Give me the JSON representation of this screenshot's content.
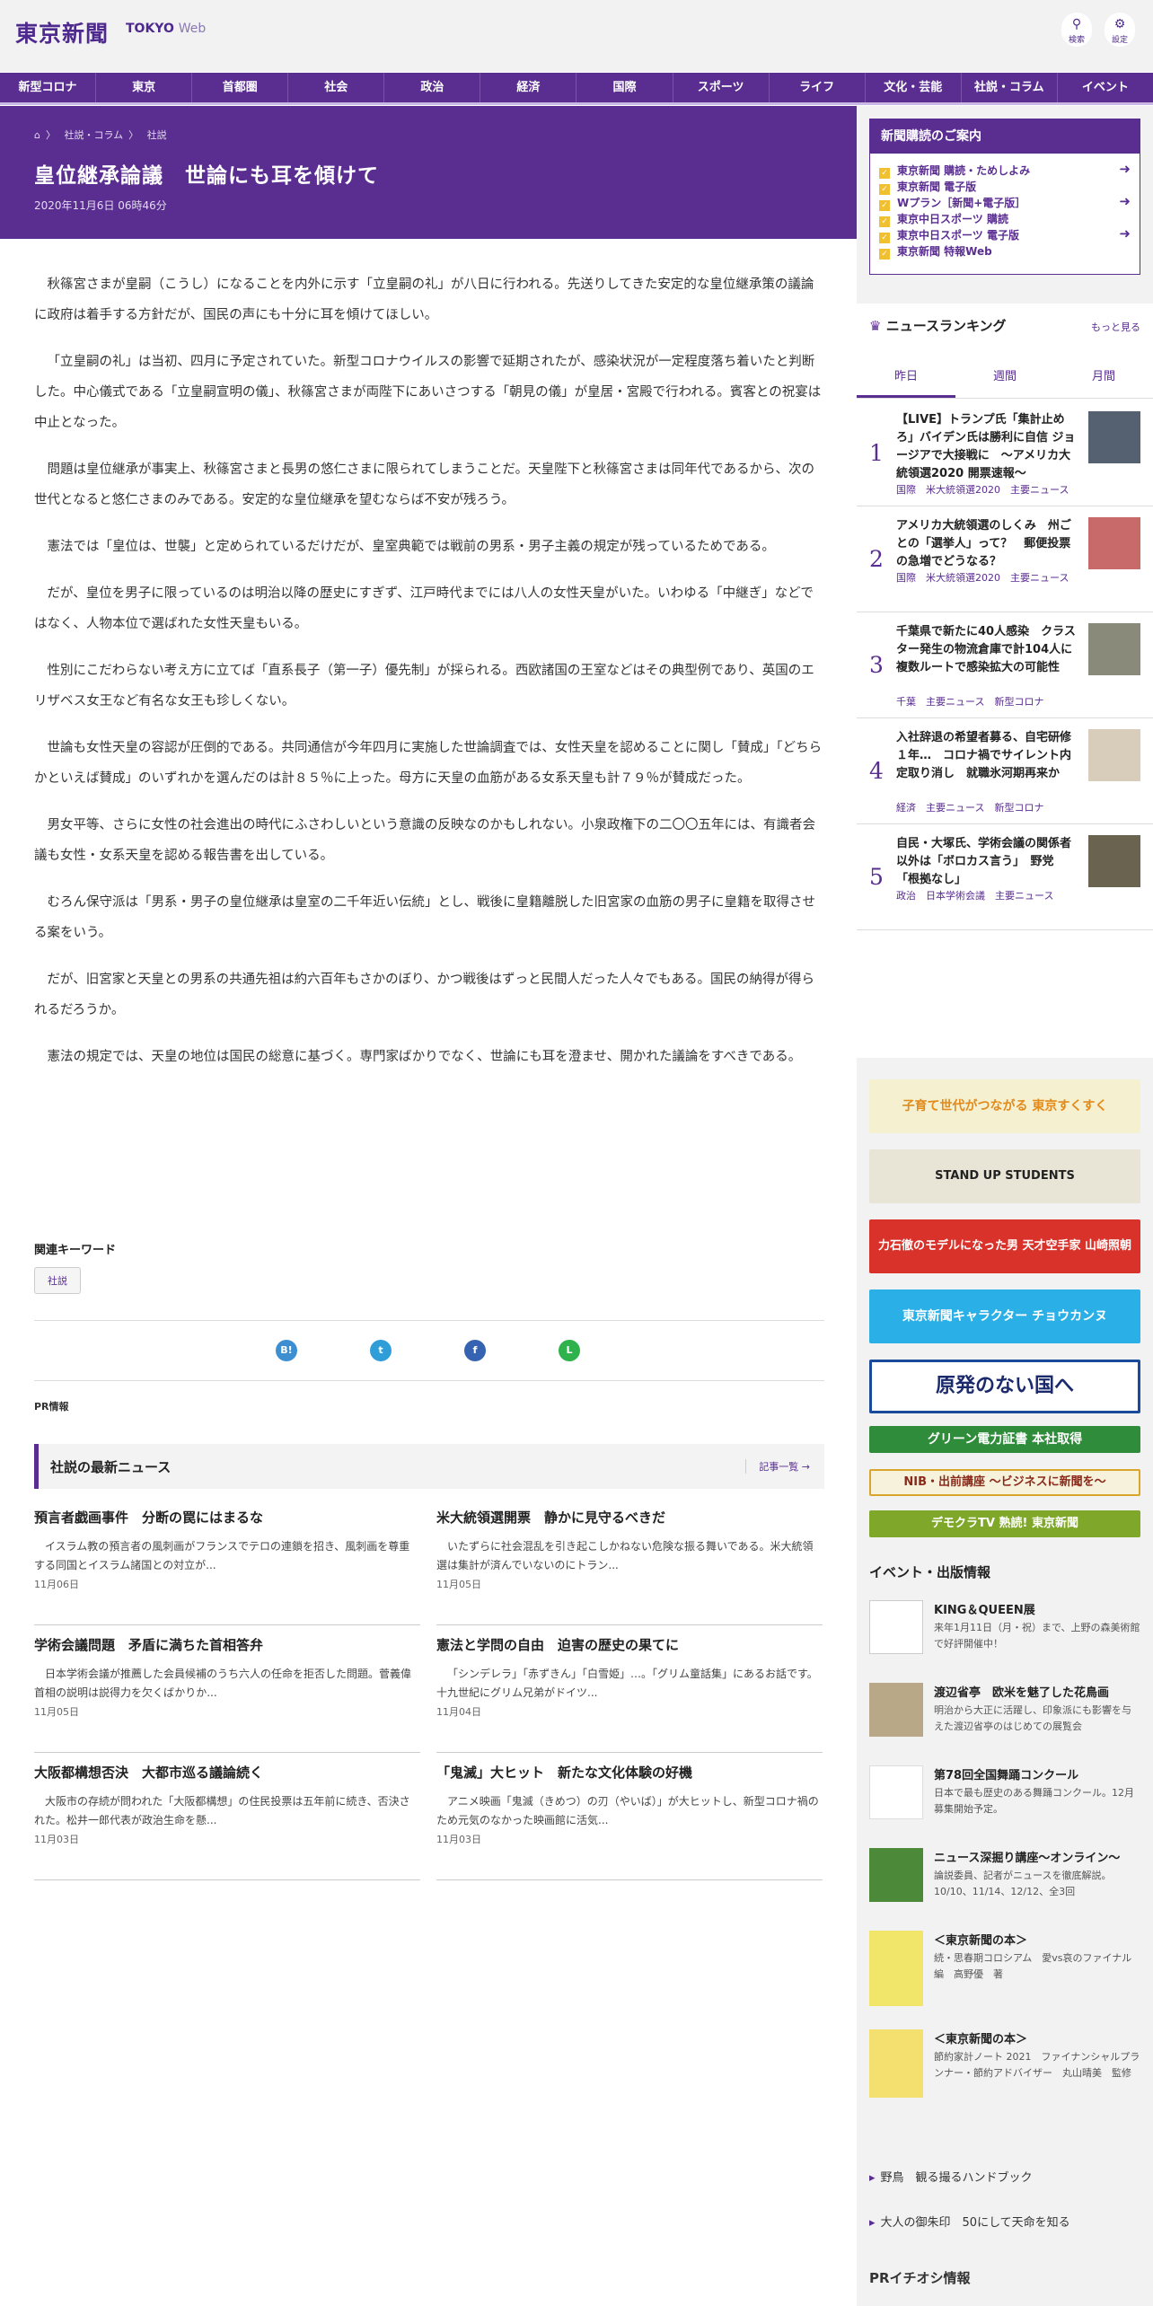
{
  "header": {
    "logo": "東京新聞",
    "logo_sub": "TOKYO",
    "logo_web": "Web",
    "search_label": "検索",
    "settings_label": "設定"
  },
  "nav": [
    "新型コロナ",
    "東京",
    "首都圏",
    "社会",
    "政治",
    "経済",
    "国際",
    "スポーツ",
    "ライフ",
    "文化・芸能",
    "社説・コラム",
    "イベント"
  ],
  "breadcrumb": [
    "社説・コラム",
    "社説"
  ],
  "article": {
    "title": "皇位継承論議　世論にも耳を傾けて",
    "date": "2020年11月6日 06時46分",
    "paragraphs": [
      "秋篠宮さまが皇嗣（こうし）になることを内外に示す「立皇嗣の礼」が八日に行われる。先送りしてきた安定的な皇位継承策の議論に政府は着手する方針だが、国民の声にも十分に耳を傾けてほしい。",
      "「立皇嗣の礼」は当初、四月に予定されていた。新型コロナウイルスの影響で延期されたが、感染状況が一定程度落ち着いたと判断した。中心儀式である「立皇嗣宣明の儀」、秋篠宮さまが両陛下にあいさつする「朝見の儀」が皇居・宮殿で行われる。賓客との祝宴は中止となった。",
      "問題は皇位継承が事実上、秋篠宮さまと長男の悠仁さまに限られてしまうことだ。天皇陛下と秋篠宮さまは同年代であるから、次の世代となると悠仁さまのみである。安定的な皇位継承を望むならば不安が残ろう。",
      "憲法では「皇位は、世襲」と定められているだけだが、皇室典範では戦前の男系・男子主義の規定が残っているためである。",
      "だが、皇位を男子に限っているのは明治以降の歴史にすぎず、江戸時代までには八人の女性天皇がいた。いわゆる「中継ぎ」などではなく、人物本位で選ばれた女性天皇もいる。",
      "性別にこだわらない考え方に立てば「直系長子（第一子）優先制」が採られる。西欧諸国の王室などはその典型例であり、英国のエリザベス女王など有名な女王も珍しくない。",
      "世論も女性天皇の容認が圧倒的である。共同通信が今年四月に実施した世論調査では、女性天皇を認めることに関し「賛成」「どちらかといえば賛成」のいずれかを選んだのは計８５％に上った。母方に天皇の血筋がある女系天皇も計７９％が賛成だった。",
      "男女平等、さらに女性の社会進出の時代にふさわしいという意識の反映なのかもしれない。小泉政権下の二〇〇五年には、有識者会議も女性・女系天皇を認める報告書を出している。",
      "むろん保守派は「男系・男子の皇位継承は皇室の二千年近い伝統」とし、戦後に皇籍離脱した旧宮家の血筋の男子に皇籍を取得させる案をいう。",
      "だが、旧宮家と天皇との男系の共通先祖は約六百年もさかのぼり、かつ戦後はずっと民間人だった人々でもある。国民の納得が得られるだろうか。",
      "憲法の規定では、天皇の地位は国民の総意に基づく。専門家ばかりでなく、世論にも耳を澄ませ、開かれた議論をすべきである。"
    ]
  },
  "keywords": {
    "label": "関連キーワード",
    "tag": "社説"
  },
  "share": [
    "B!",
    "t",
    "f",
    "L"
  ],
  "pr_label": "PR情報",
  "latest": {
    "title": "社説の最新ニュース",
    "more": "記事一覧 →",
    "items": [
      {
        "h": "預言者戯画事件　分断の罠にはまるな",
        "b": "イスラム教の預言者の風刺画がフランスでテロの連鎖を招き、風刺画を尊重する同国とイスラム諸国との対立が...",
        "d": "11月06日"
      },
      {
        "h": "米大統領選開票　静かに見守るべきだ",
        "b": "いたずらに社会混乱を引き起こしかねない危険な振る舞いである。米大統領選は集計が済んでいないのにトラン...",
        "d": "11月05日"
      },
      {
        "h": "学術会議問題　矛盾に満ちた首相答弁",
        "b": "日本学術会議が推薦した会員候補のうち六人の任命を拒否した問題。菅義偉首相の説明は説得力を欠くばかりか...",
        "d": "11月05日"
      },
      {
        "h": "憲法と学問の自由　迫害の歴史の果てに",
        "b": "「シンデレラ」「赤ずきん」「白雪姫」…。「グリム童話集」にあるお話です。十九世紀にグリム兄弟がドイツ...",
        "d": "11月04日"
      },
      {
        "h": "大阪都構想否決　大都市巡る議論続く",
        "b": "大阪市の存続が問われた「大阪都構想」の住民投票は五年前に続き、否決された。松井一郎代表が政治生命を懸...",
        "d": "11月03日"
      },
      {
        "h": "「鬼滅」大ヒット　新たな文化体験の好機",
        "b": "アニメ映画「鬼滅（きめつ）の刃（やいば）」が大ヒットし、新型コロナ禍のため元気のなかった映画館に活気...",
        "d": "11月03日"
      }
    ]
  },
  "subscription": {
    "title": "新聞購読のご案内",
    "items": [
      "東京新聞 購読・ためしよみ",
      "東京新聞 電子版",
      "Wプラン［新聞+電子版］",
      "東京中日スポーツ 購読",
      "東京中日スポーツ 電子版",
      "東京新聞 特報Web"
    ]
  },
  "ranking": {
    "title": "ニュースランキング",
    "more": "もっと見る",
    "tabs": [
      "昨日",
      "週間",
      "月間"
    ],
    "items": [
      {
        "n": "1",
        "h": "【LIVE】トランプ氏「集計止めろ」バイデン氏は勝利に自信 ジョージアで大接戦に　～アメリカ大統領選2020 開票速報～",
        "c": "国際　米大統領選2020　主要ニュース"
      },
      {
        "n": "2",
        "h": "アメリカ大統領選のしくみ　州ごとの「選挙人」って？　郵便投票の急増でどうなる？",
        "c": "国際　米大統領選2020　主要ニュース"
      },
      {
        "n": "3",
        "h": "千葉県で新たに40人感染　クラスター発生の物流倉庫で計104人に　複数ルートで感染拡大の可能性",
        "c": "千葉　主要ニュース　新型コロナ"
      },
      {
        "n": "4",
        "h": "入社辞退の希望者募る、自宅研修１年…　コロナ禍でサイレント内定取り消し　就職氷河期再来か",
        "c": "経済　主要ニュース　新型コロナ"
      },
      {
        "n": "5",
        "h": "自民・大塚氏、学術会議の関係者以外は「ボロカス言う」　野党「根拠なし」",
        "c": "政治　日本学術会議　主要ニュース"
      }
    ]
  },
  "banners": [
    "子育て世代がつながる 東京すくすく",
    "STAND UP STUDENTS",
    "力石徹のモデルになった男 天才空手家 山崎照朝",
    "東京新聞キャラクター チョウカンヌ",
    "原発のない国へ",
    "グリーン電力証書 本社取得",
    "NIB・出前講座 ～ビジネスに新聞を～",
    "デモクラTV 熟読! 東京新聞"
  ],
  "events": {
    "title": "イベント・出版情報",
    "items": [
      {
        "t": "KING＆QUEEN展",
        "d": "来年1月11日（月・祝）まで、上野の森美術館で好評開催中！"
      },
      {
        "t": "渡辺省亭　欧米を魅了した花鳥画",
        "d": "明治から大正に活躍し、印象派にも影響を与えた渡辺省亭のはじめての展覧会"
      },
      {
        "t": "第78回全国舞踊コンクール",
        "d": "日本で最も歴史のある舞踊コンクール。12月募集開始予定。"
      },
      {
        "t": "ニュース深掘り講座～オンライン～",
        "d": "論説委員、記者がニュースを徹底解説。10/10、11/14、12/12、全3回"
      },
      {
        "t": "＜東京新聞の本＞",
        "d": "続・思春期コロシアム　愛vs哀のファイナル編　高野優　著"
      },
      {
        "t": "＜東京新聞の本＞",
        "d": "節約家計ノート 2021　ファイナンシャルプランナー・節約アドバイザー　丸山晴美　監修"
      }
    ]
  },
  "links": [
    "野鳥　観る撮るハンドブック",
    "大人の御朱印　50にして天命を知る"
  ],
  "pr_recommend": "PRイチオシ情報"
}
